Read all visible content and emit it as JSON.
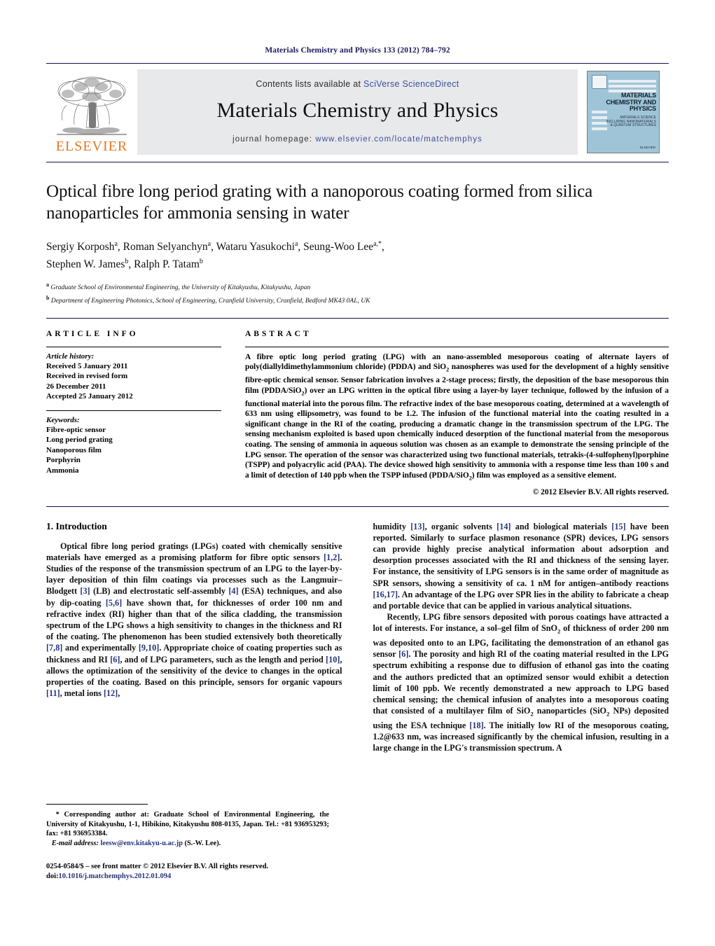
{
  "running_head": "Materials Chemistry and Physics 133 (2012) 784–792",
  "banner": {
    "publisher_wordmark": "ELSEVIER",
    "contents_prefix": "Contents lists available at ",
    "contents_link": "SciVerse ScienceDirect",
    "journal_name": "Materials Chemistry and Physics",
    "homepage_prefix": "journal homepage: ",
    "homepage_url": "www.elsevier.com/locate/matchemphys",
    "cover": {
      "title_line1": "MATERIALS",
      "title_line2": "CHEMISTRY AND",
      "title_line3": "PHYSICS",
      "subtitle_line1": "MATERIALS SCIENCE",
      "subtitle_line2": "INCLUDING NANOMATERIALS",
      "subtitle_line3": "& QUANTUM STRUCTURES",
      "footer": "ELSEVIER"
    }
  },
  "article": {
    "title": "Optical fibre long period grating with a nanoporous coating formed from silica nanoparticles for ammonia sensing in water",
    "authors_line1": "Sergiy Korposh",
    "authors_line1_b": "Roman Selyanchyn",
    "authors_line1_c": "Wataru Yasukochi",
    "authors_line1_d": "Seung-Woo Lee",
    "authors_line2_a": "Stephen W. James",
    "authors_line2_b": "Ralph P. Tatam",
    "affiliation_a": "Graduate School of Environmental Engineering, the University of Kitakyushu, Kitakyushu, Japan",
    "affiliation_b": "Department of Engineering Photonics, School of Engineering, Cranfield University, Cranfield, Bedford MK43 0AL, UK"
  },
  "article_info": {
    "label": "ARTICLE INFO",
    "history_head": "Article history:",
    "history": [
      "Received 5 January 2011",
      "Received in revised form",
      "26 December 2011",
      "Accepted 25 January 2012"
    ],
    "keywords_head": "Keywords:",
    "keywords": [
      "Fibre-optic sensor",
      "Long period grating",
      "Nanoporous film",
      "Porphyrin",
      "Ammonia"
    ]
  },
  "abstract": {
    "label": "ABSTRACT",
    "p1": "A fibre optic long period grating (LPG) with an nano-assembled mesoporous coating of alternate layers of poly(diallyldimethylammonium chloride) (PDDA) and SiO",
    "p1b": " nanospheres was used for the development of a highly sensitive fibre-optic chemical sensor. Sensor fabrication involves a 2-stage process; firstly, the deposition of the base mesoporous thin film (PDDA/SiO",
    "p1c": ") over an LPG written in the optical fibre using a layer-by layer technique, followed by the infusion of a functional material into the porous film. The refractive index of the base mesoporous coating, determined at a wavelength of 633 nm using ellipsometry, was found to be 1.2. The infusion of the functional material into the coating resulted in a significant change in the RI of the coating, producing a dramatic change in the transmission spectrum of the LPG. The sensing mechanism exploited is based upon chemically induced desorption of the functional material from the mesoporous coating. The sensing of ammonia in aqueous solution was chosen as an example to demonstrate the sensing principle of the LPG sensor. The operation of the sensor was characterized using two functional materials, tetrakis-(4-sulfophenyl)porphine (TSPP) and polyacrylic acid (PAA). The device showed high sensitivity to ammonia with a response time less than 100 s and a limit of detection of 140 ppb when the TSPP infused (PDDA/SiO",
    "p1d": ") film was employed as a sensitive element.",
    "copyright": "© 2012 Elsevier B.V. All rights reserved."
  },
  "introduction": {
    "heading": "1. Introduction",
    "left_p1_a": "Optical fibre long period gratings (LPGs) coated with chemically sensitive materials have emerged as a promising platform for fibre optic sensors ",
    "left_ref_12": "[1,2]",
    "left_p1_b": ". Studies of the response of the transmission spectrum of an LPG to the layer-by-layer deposition of thin film coatings via processes such as the Langmuir–Blodgett ",
    "left_ref_3": "[3]",
    "left_p1_c": " (LB) and electrostatic self-assembly ",
    "left_ref_4": "[4]",
    "left_p1_d": " (ESA) techniques, and also by dip-coating ",
    "left_ref_56": "[5,6]",
    "left_p1_e": " have shown that, for thicknesses of order 100 nm and refractive index (RI) higher than that of the silica cladding, the transmission spectrum of the LPG shows a high sensitivity to changes in the thickness and RI of the coating. The phenomenon has been studied extensively both theoretically ",
    "left_ref_78": "[7,8]",
    "left_p1_f": " and experimentally ",
    "left_ref_910": "[9,10]",
    "left_p1_g": ". Appropriate choice of coating properties such as thickness and RI ",
    "left_ref_6": "[6]",
    "left_p1_h": ", and of LPG parameters, such as the length and period ",
    "left_ref_10": "[10]",
    "left_p1_i": ", allows the optimization of the sensitivity of the device to changes in the optical properties of the coating. Based on this principle, sensors for organic vapours ",
    "left_ref_11": "[11]",
    "left_p1_j": ", metal ions ",
    "left_ref_12b": "[12]",
    "left_p1_k": ",",
    "right_p1_a": "humidity ",
    "right_ref_13": "[13]",
    "right_p1_b": ", organic solvents ",
    "right_ref_14": "[14]",
    "right_p1_c": " and biological materials ",
    "right_ref_15": "[15]",
    "right_p1_d": " have been reported. Similarly to surface plasmon resonance (SPR) devices, LPG sensors can provide highly precise analytical information about adsorption and desorption processes associated with the RI and thickness of the sensing layer. For instance, the sensitivity of LPG sensors is in the same order of magnitude as SPR sensors, showing a sensitivity of ca. 1 nM for antigen–antibody reactions ",
    "right_ref_1617": "[16,17]",
    "right_p1_e": ". An advantage of the LPG over SPR lies in the ability to fabricate a cheap and portable device that can be applied in various analytical situations.",
    "right_p2_a": "Recently, LPG fibre sensors deposited with porous coatings have attracted a lot of interests. For instance, a sol–gel film of SnO",
    "right_p2_b": " of thickness of order 200 nm was deposited onto to an LPG, facilitating the demonstration of an ethanol gas sensor ",
    "right_ref_6": "[6]",
    "right_p2_c": ". The porosity and high RI of the coating material resulted in the LPG spectrum exhibiting a response due to diffusion of ethanol gas into the coating and the authors predicted that an optimized sensor would exhibit a detection limit of 100 ppb. We recently demonstrated a new approach to LPG based chemical sensing; the chemical infusion of analytes into a mesoporous coating that consisted of a multilayer film of SiO",
    "right_p2_d": " nanoparticles (SiO",
    "right_p2_e": " NPs) deposited using the ESA technique ",
    "right_ref_18": "[18]",
    "right_p2_f": ". The initially low RI of the mesoporous coating, 1.2@633 nm, was increased significantly by the chemical infusion, resulting in a large change in the LPG's transmission spectrum. A"
  },
  "footnote": {
    "star": "*",
    "corresponding": " Corresponding author at: Graduate School of Environmental Engineering, the University of Kitakyushu, 1-1, Hibikino, Kitakyushu 808-0135, Japan. Tel.: +81 936953293; fax: +81 936953384.",
    "email_label": "E-mail address:",
    "email": "leesw@env.kitakyu-u.ac.jp",
    "email_suffix": " (S.-W. Lee).",
    "issn_line": "0254-0584/$ – see front matter © 2012 Elsevier B.V. All rights reserved.",
    "doi_label": "doi:",
    "doi": "10.1016/j.matchemphys.2012.01.094"
  },
  "colors": {
    "navy": "#12124a",
    "link": "#3a4fa0",
    "ref": "#23347a",
    "elsevier_orange": "#e87722",
    "banner_grey": "#e8e9ea",
    "cover_blue": "#9fc4d8"
  }
}
